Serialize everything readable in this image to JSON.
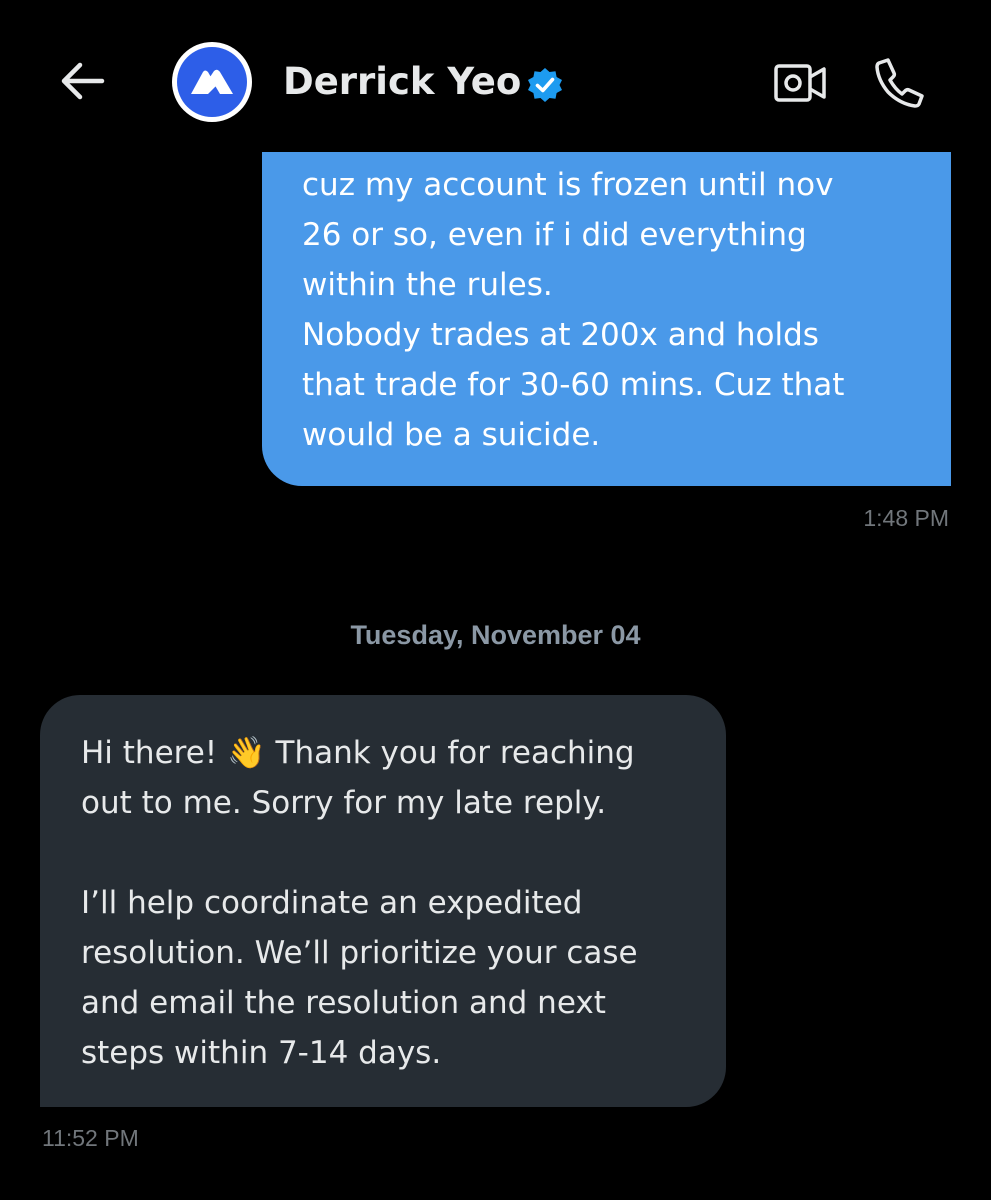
{
  "header": {
    "contact_name": "Derrick Yeo",
    "verified": true,
    "icons": {
      "back": "back-arrow-icon",
      "avatar_logo": "mexc-logo-icon",
      "verified": "verified-badge-icon",
      "video": "video-call-icon",
      "call": "phone-call-icon"
    }
  },
  "messages": [
    {
      "direction": "outgoing",
      "text": "cuz my account is frozen until nov\n26 or so, even if i did everything\nwithin the rules.\nNobody trades at 200x and holds\nthat trade for 30-60 mins. Cuz that\nwould be a suicide.",
      "time": "1:48 PM"
    },
    {
      "direction": "incoming",
      "text": "Hi there! 👋 Thank you for reaching\nout to me. Sorry for my late reply.\n\nI’ll help coordinate an expedited\nresolution. We’ll prioritize your case\nand email the resolution and next\nsteps within 7-14 days.",
      "time": "11:52 PM"
    }
  ],
  "date_separator": "Tuesday, November 04",
  "colors": {
    "background": "#000000",
    "outgoing_bubble": "#4a99e9",
    "incoming_bubble": "#262d34",
    "verified": "#1d9bf0",
    "avatar_brand": "#2d5ee8",
    "timestamp": "#71767b"
  }
}
